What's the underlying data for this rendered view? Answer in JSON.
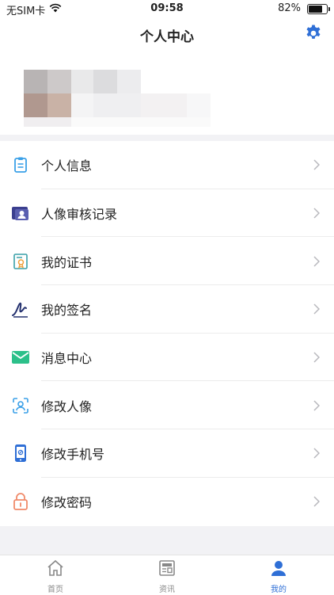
{
  "status_bar": {
    "carrier": "无SIM卡",
    "time": "09:58",
    "battery": "82%",
    "battery_level": 0.82
  },
  "header": {
    "title": "个人中心",
    "settings_icon": "gear-icon"
  },
  "menu": [
    {
      "label": "个人信息",
      "icon": "clipboard-icon",
      "color": "#3aa0e8"
    },
    {
      "label": "人像审核记录",
      "icon": "id-card-icon",
      "color": "#3b3f8f"
    },
    {
      "label": "我的证书",
      "icon": "certificate-icon",
      "color": "#3aa0a8"
    },
    {
      "label": "我的签名",
      "icon": "signature-icon",
      "color": "#23306e"
    },
    {
      "label": "消息中心",
      "icon": "envelope-icon",
      "color": "#2cc08a"
    },
    {
      "label": "修改人像",
      "icon": "face-scan-icon",
      "color": "#3aa0e8"
    },
    {
      "label": "修改手机号",
      "icon": "phone-icon",
      "color": "#2f6fd6"
    },
    {
      "label": "修改密码",
      "icon": "lock-icon",
      "color": "#f08a6a"
    }
  ],
  "tabs": [
    {
      "label": "首页",
      "icon": "home-icon",
      "active": false
    },
    {
      "label": "资讯",
      "icon": "news-icon",
      "active": false
    },
    {
      "label": "我的",
      "icon": "user-icon",
      "active": true
    }
  ],
  "colors": {
    "accent": "#2f6fd6",
    "background": "#f2f2f5"
  }
}
